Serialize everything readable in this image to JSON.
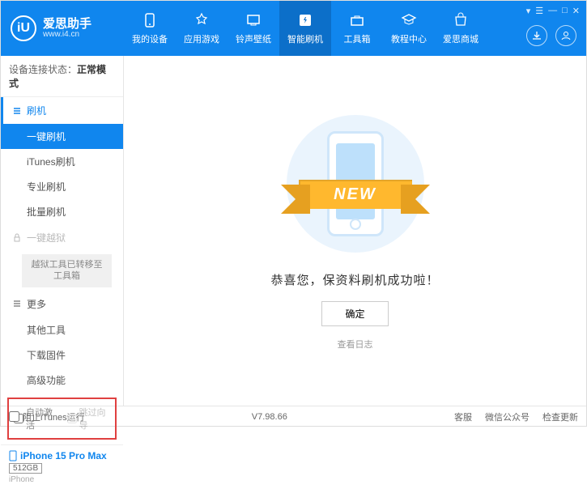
{
  "header": {
    "logo_letter": "iU",
    "title": "爱思助手",
    "subtitle": "www.i4.cn",
    "window_controls": [
      "▾",
      "☰",
      "—",
      "□",
      "✕"
    ]
  },
  "nav": [
    {
      "label": "我的设备"
    },
    {
      "label": "应用游戏"
    },
    {
      "label": "铃声壁纸"
    },
    {
      "label": "智能刷机",
      "active": true
    },
    {
      "label": "工具箱"
    },
    {
      "label": "教程中心"
    },
    {
      "label": "爱思商城"
    }
  ],
  "sidebar": {
    "status_label": "设备连接状态：",
    "status_value": "正常模式",
    "section_flash": "刷机",
    "items_flash": [
      {
        "label": "一键刷机",
        "active": true
      },
      {
        "label": "iTunes刷机"
      },
      {
        "label": "专业刷机"
      },
      {
        "label": "批量刷机"
      }
    ],
    "section_jailbreak": "一键越狱",
    "jailbreak_note": "越狱工具已转移至工具箱",
    "section_more": "更多",
    "items_more": [
      {
        "label": "其他工具"
      },
      {
        "label": "下载固件"
      },
      {
        "label": "高级功能"
      }
    ],
    "checkbox1": "自动激活",
    "checkbox2": "跳过向导",
    "device_name": "iPhone 15 Pro Max",
    "storage": "512GB",
    "device_type": "iPhone"
  },
  "main": {
    "ribbon": "NEW",
    "success": "恭喜您，保资料刷机成功啦！",
    "ok": "确定",
    "view_log": "查看日志"
  },
  "footer": {
    "block_itunes": "阻止iTunes运行",
    "version": "V7.98.66",
    "links": [
      "客服",
      "微信公众号",
      "检查更新"
    ]
  }
}
